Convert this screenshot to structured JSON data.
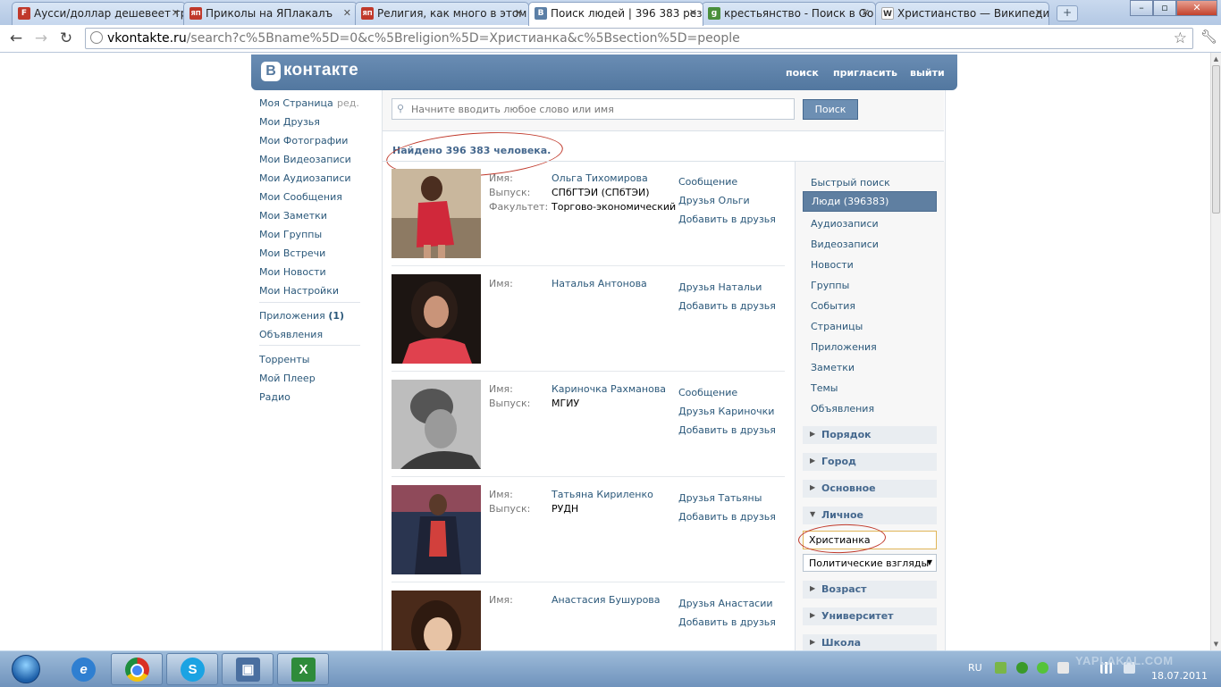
{
  "browser": {
    "tabs": [
      {
        "title": "Аусси/доллар дешевеет тр",
        "favicon": "F",
        "favicon_color": "#c0392b",
        "active": false
      },
      {
        "title": "Приколы на ЯПлакалъ",
        "favicon": "ЯП",
        "favicon_color": "#c0392b",
        "active": false
      },
      {
        "title": "Религия, как много в этом",
        "favicon": "ЯП",
        "favicon_color": "#c0392b",
        "active": false
      },
      {
        "title": "Поиск людей | 396 383 рез",
        "favicon": "B",
        "favicon_color": "#5b7fa6",
        "active": true
      },
      {
        "title": "крестьянство - Поиск в Go",
        "favicon": "g",
        "favicon_color": "#4a8f3c",
        "active": false
      },
      {
        "title": "Христианство — Википеди",
        "favicon": "W",
        "favicon_color": "#444444",
        "active": false
      }
    ],
    "url_host": "vkontakte.ru",
    "url_rest": "/search?c%5Bname%5D=0&c%5Breligion%5D=Христианка&c%5Bsection%5D=people"
  },
  "vk": {
    "logo_letter": "B",
    "logo_text": "контакте",
    "top_links": [
      "поиск",
      "пригласить",
      "выйти"
    ],
    "left_menu": {
      "my_page": "Моя Страница",
      "edit": "ред.",
      "items": [
        "Мои Друзья",
        "Мои Фотографии",
        "Мои Видеозаписи",
        "Мои Аудиозаписи",
        "Мои Сообщения",
        "Мои Заметки",
        "Мои Группы",
        "Мои Встречи",
        "Мои Новости",
        "Мои Настройки"
      ],
      "apps": "Приложения",
      "apps_count": "(1)",
      "ads": "Объявления",
      "extra": [
        "Торренты",
        "Мой Плеер",
        "Радио"
      ]
    },
    "search": {
      "placeholder": "Начните вводить любое слово или имя",
      "button": "Поиск"
    },
    "summary": "Найдено 396 383 человека.",
    "people": [
      {
        "fields": [
          {
            "label": "Имя:",
            "value": "Ольга Тихомирова"
          },
          {
            "label": "Выпуск:",
            "value": "СПбГТЭИ (СПбТЭИ)"
          },
          {
            "label": "Факультет:",
            "value": "Торгово-экономический"
          }
        ],
        "actions": [
          "Сообщение",
          "Друзья Ольги",
          "Добавить в друзья"
        ],
        "photo_colors": [
          "#c9b79d",
          "#d0283a"
        ]
      },
      {
        "fields": [
          {
            "label": "Имя:",
            "value": "Наталья Антонова"
          }
        ],
        "actions": [
          "Друзья Натальи",
          "Добавить в друзья"
        ],
        "photo_colors": [
          "#1c1512",
          "#e0414e"
        ]
      },
      {
        "fields": [
          {
            "label": "Имя:",
            "value": "Кариночка Рахманова"
          },
          {
            "label": "Выпуск:",
            "value": "МГИУ"
          }
        ],
        "actions": [
          "Сообщение",
          "Друзья Кариночки",
          "Добавить в друзья"
        ],
        "photo_colors": [
          "#9a9a9a",
          "#3a3a3a"
        ]
      },
      {
        "fields": [
          {
            "label": "Имя:",
            "value": "Татьяна Кириленко"
          },
          {
            "label": "Выпуск:",
            "value": "РУДН"
          }
        ],
        "actions": [
          "Друзья Татьяны",
          "Добавить в друзья"
        ],
        "photo_colors": [
          "#2a3550",
          "#d2403c"
        ]
      },
      {
        "fields": [
          {
            "label": "Имя:",
            "value": "Анастасия Бушурова"
          }
        ],
        "actions": [
          "Друзья Анастасии",
          "Добавить в друзья"
        ],
        "photo_colors": [
          "#4a2a1a",
          "#e7c3a5"
        ]
      }
    ],
    "filters": {
      "links": [
        "Быстрый поиск",
        "Аудиозаписи",
        "Видеозаписи",
        "Новости",
        "Группы",
        "События",
        "Страницы",
        "Приложения",
        "Заметки",
        "Темы",
        "Объявления"
      ],
      "active": "Люди (396383)",
      "sections": [
        "Порядок",
        "Город",
        "Основное",
        "Личное",
        "Возраст",
        "Университет",
        "Школа"
      ],
      "religion_value": "Христианка",
      "politics_placeholder": "Политические взгляды"
    },
    "accent_color": "#5b7fa6",
    "link_color": "#2b587a"
  },
  "taskbar": {
    "lang": "RU",
    "date": "18.07.2011",
    "watermark": "YAPLAKAL.COM"
  }
}
